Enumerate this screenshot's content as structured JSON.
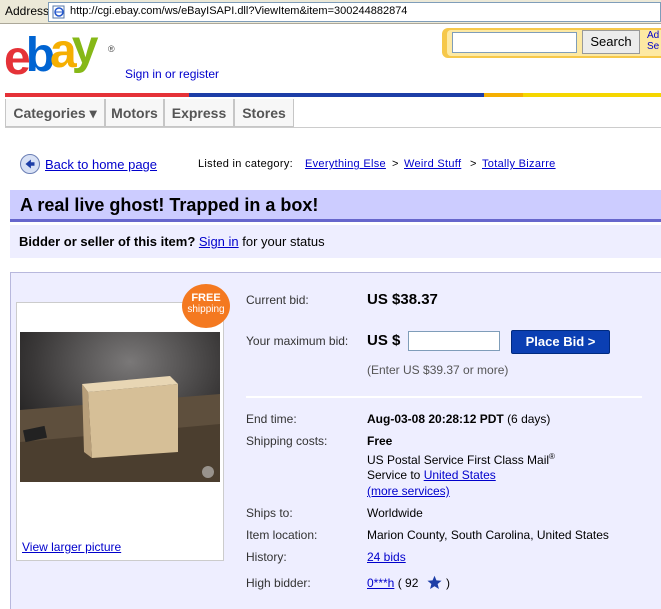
{
  "address_bar": {
    "label": "Address",
    "url": "http://cgi.ebay.com/ws/eBayISAPI.dll?ViewItem&item=300244882874"
  },
  "header": {
    "logo_letters": [
      "e",
      "b",
      "a",
      "y"
    ],
    "logo_registered": "®",
    "sign_in_text": "Sign in or register",
    "search_button": "Search",
    "advanced_search_line1": "Ad",
    "advanced_search_line2": "Se"
  },
  "colors": {
    "logo_red": "#e53238",
    "logo_blue": "#0064d2",
    "logo_yellow": "#f5af02",
    "logo_green": "#86b817",
    "title_bar": "#ccccff",
    "panel_bg": "#eeeeff",
    "link": "#0000cc",
    "bid_button": "#0b3fb3",
    "badge": "#f47920"
  },
  "nav": {
    "tabs": [
      "Categories ▾",
      "Motors",
      "Express",
      "Stores"
    ]
  },
  "breadcrumb": {
    "back_link": "Back to home page",
    "listed_label": "Listed in category:",
    "categories": [
      "Everything Else",
      "Weird Stuff",
      "Totally Bizarre"
    ],
    "separator": ">"
  },
  "listing": {
    "title": "A real live ghost! Trapped in a box!",
    "status_bold": "Bidder or seller of this item?",
    "status_link": "Sign in",
    "status_rest": "for your status",
    "badge_line1": "FREE",
    "badge_line2": "shipping",
    "larger_picture": "View larger picture"
  },
  "bid": {
    "current_bid_label": "Current bid:",
    "current_bid_value": "US $38.37",
    "max_bid_label": "Your maximum bid:",
    "currency_prefix": "US $",
    "bid_input_value": "",
    "place_bid_button": "Place Bid >",
    "hint": "(Enter US $39.37 or more)"
  },
  "details": {
    "end_time_label": "End time:",
    "end_time_value": "Aug-03-08 20:28:12 PDT",
    "end_time_remaining": "(6 days)",
    "shipping_label": "Shipping costs:",
    "shipping_value": "Free",
    "shipping_service": "US Postal Service First Class Mail",
    "shipping_service_reg": "®",
    "service_to_prefix": "Service to",
    "service_to_link": "United States",
    "more_services": "(more services)",
    "ships_to_label": "Ships to:",
    "ships_to_value": "Worldwide",
    "location_label": "Item location:",
    "location_value": "Marion County, South Carolina, United States",
    "history_label": "History:",
    "history_value": "24 bids",
    "high_bidder_label": "High bidder:",
    "high_bidder_name": "0***h",
    "high_bidder_open": "( 92",
    "high_bidder_close": ")"
  }
}
